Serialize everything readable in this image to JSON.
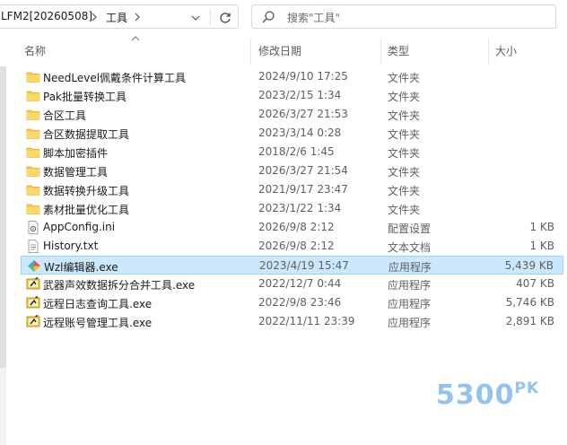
{
  "address": {
    "crumbs": [
      "LFM2[20260508]",
      "工具"
    ]
  },
  "search": {
    "placeholder": "搜索\"工具\""
  },
  "columns": {
    "name": "名称",
    "date": "修改日期",
    "type": "类型",
    "size": "大小"
  },
  "files": [
    {
      "name": "NeedLevel佩戴条件计算工具",
      "date": "2024/9/10 17:25",
      "type": "文件夹",
      "size": "",
      "icon": "folder-icon"
    },
    {
      "name": "Pak批量转换工具",
      "date": "2023/2/15 1:34",
      "type": "文件夹",
      "size": "",
      "icon": "folder-icon"
    },
    {
      "name": "合区工具",
      "date": "2026/3/27 21:53",
      "type": "文件夹",
      "size": "",
      "icon": "folder-icon"
    },
    {
      "name": "合区数据提取工具",
      "date": "2023/3/14 0:28",
      "type": "文件夹",
      "size": "",
      "icon": "folder-icon"
    },
    {
      "name": "脚本加密插件",
      "date": "2018/2/6 1:45",
      "type": "文件夹",
      "size": "",
      "icon": "folder-icon"
    },
    {
      "name": "数据管理工具",
      "date": "2026/3/27 21:54",
      "type": "文件夹",
      "size": "",
      "icon": "folder-icon"
    },
    {
      "name": "数据转换升级工具",
      "date": "2021/9/17 23:47",
      "type": "文件夹",
      "size": "",
      "icon": "folder-icon"
    },
    {
      "name": "素材批量优化工具",
      "date": "2023/1/22 1:34",
      "type": "文件夹",
      "size": "",
      "icon": "folder-icon"
    },
    {
      "name": "AppConfig.ini",
      "date": "2026/9/8 2:12",
      "type": "配置设置",
      "size": "1 KB",
      "icon": "config-file-icon"
    },
    {
      "name": "History.txt",
      "date": "2026/9/8 2:12",
      "type": "文本文档",
      "size": "1 KB",
      "icon": "text-file-icon"
    },
    {
      "name": "Wzl编辑器.exe",
      "date": "2023/4/19 15:47",
      "type": "应用程序",
      "size": "5,439 KB",
      "icon": "colorful-app-icon",
      "selected": true
    },
    {
      "name": "武器声效数据拆分合并工具.exe",
      "date": "2022/12/7 0:44",
      "type": "应用程序",
      "size": "407 KB",
      "icon": "app-exe-icon"
    },
    {
      "name": "远程日志查询工具.exe",
      "date": "2022/9/8 23:46",
      "type": "应用程序",
      "size": "5,746 KB",
      "icon": "app-exe-icon"
    },
    {
      "name": "远程账号管理工具.exe",
      "date": "2022/11/11 23:39",
      "type": "应用程序",
      "size": "2,891 KB",
      "icon": "app-exe-icon"
    }
  ],
  "watermark": {
    "text": "5300",
    "suffix": "PK"
  },
  "colors": {
    "folder": "#f8c94e",
    "selection": "#cce8ff",
    "selection_border": "#99d1ff",
    "watermark": "#7fb8ea"
  }
}
